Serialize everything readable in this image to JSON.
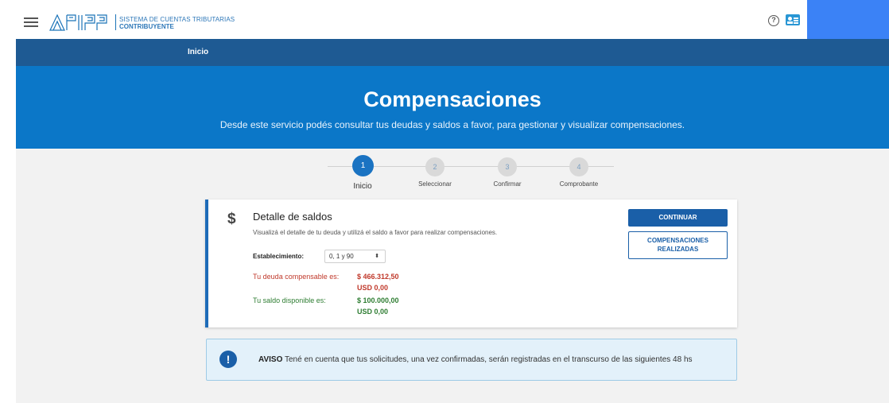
{
  "header": {
    "system_name": "SISTEMA DE CUENTAS TRIBUTARIAS",
    "role": "CONTRIBUYENTE",
    "logo_text": "AFIP",
    "help_icon": "help-circle-icon",
    "profile_icon": "id-card-icon",
    "help_glyph": "?"
  },
  "nav": {
    "items": [
      {
        "label": "Inicio"
      }
    ]
  },
  "hero": {
    "title": "Compensaciones",
    "subtitle": "Desde este servicio podés consultar tus deudas y saldos a favor, para gestionar y visualizar compensaciones."
  },
  "stepper": {
    "steps": [
      {
        "number": "1",
        "label": "Inicio",
        "active": true
      },
      {
        "number": "2",
        "label": "Seleccionar",
        "active": false
      },
      {
        "number": "3",
        "label": "Confirmar",
        "active": false
      },
      {
        "number": "4",
        "label": "Comprobante",
        "active": false
      }
    ]
  },
  "card": {
    "icon": "dollar-icon",
    "icon_glyph": "$",
    "title": "Detalle de saldos",
    "description": "Visualizá el detalle de tu deuda y utilizá el saldo a favor para realizar compensaciones.",
    "establecimiento_label": "Establecimiento:",
    "establecimiento_value": "0, 1 y 90",
    "select_arrow": "⬍",
    "debt_label": "Tu deuda compensable es:",
    "debt_ars": "$ 466.312,50",
    "debt_usd": "USD 0,00",
    "balance_label": "Tu saldo disponible es:",
    "balance_ars": "$ 100.000,00",
    "balance_usd": "USD 0,00",
    "continue_button": "CONTINUAR",
    "realizadas_button_line1": "COMPENSACIONES",
    "realizadas_button_line2": "REALIZADAS"
  },
  "notice": {
    "icon": "exclamation-icon",
    "icon_glyph": "!",
    "prefix": "AVISO",
    "text": " Tené en cuenta que tus solicitudes, una vez confirmadas, serán registradas en el transcurso de las siguientes 48 hs"
  },
  "colors": {
    "primary": "#1a5fa8",
    "hero": "#0b77c8",
    "navbar": "#1e5a93",
    "debt": "#c0392b",
    "balance": "#2e7d32"
  }
}
